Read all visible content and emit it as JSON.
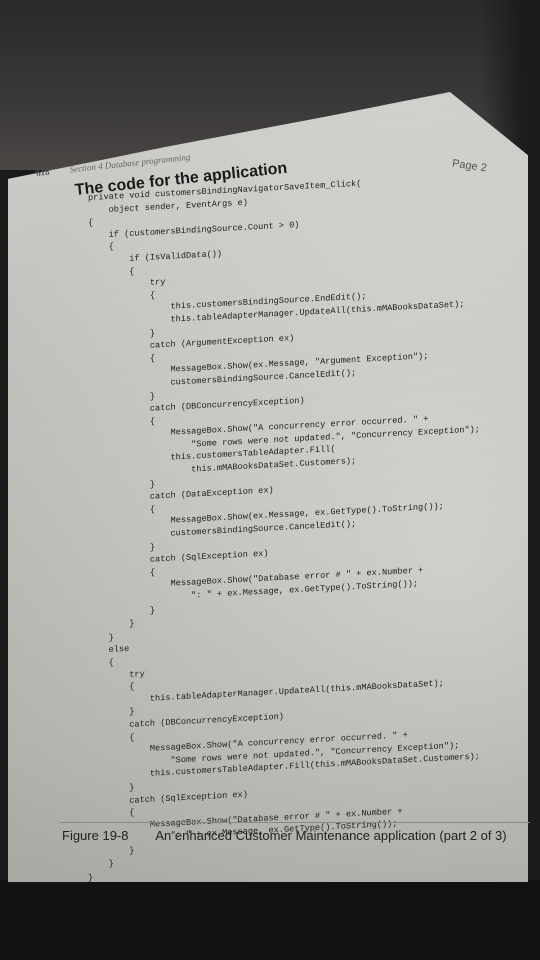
{
  "header": {
    "page_number": "618",
    "section": "Section 4    Database programming",
    "page_mark": "Page 2"
  },
  "title": "The code for the application",
  "code_lines": [
    "private void customersBindingNavigatorSaveItem_Click(",
    "    object sender, EventArgs e)",
    "{",
    "    if (customersBindingSource.Count > 0)",
    "    {",
    "        if (IsValidData())",
    "        {",
    "            try",
    "            {",
    "                this.customersBindingSource.EndEdit();",
    "                this.tableAdapterManager.UpdateAll(this.mMABooksDataSet);",
    "            }",
    "            catch (ArgumentException ex)",
    "            {",
    "                MessageBox.Show(ex.Message, \"Argument Exception\");",
    "                customersBindingSource.CancelEdit();",
    "            }",
    "            catch (DBConcurrencyException)",
    "            {",
    "                MessageBox.Show(\"A concurrency error occurred. \" +",
    "                    \"Some rows were not updated.\", \"Concurrency Exception\");",
    "                this.customersTableAdapter.Fill(",
    "                    this.mMABooksDataSet.Customers);",
    "            }",
    "            catch (DataException ex)",
    "            {",
    "                MessageBox.Show(ex.Message, ex.GetType().ToString());",
    "                customersBindingSource.CancelEdit();",
    "            }",
    "            catch (SqlException ex)",
    "            {",
    "                MessageBox.Show(\"Database error # \" + ex.Number +",
    "                    \": \" + ex.Message, ex.GetType().ToString());",
    "            }",
    "        }",
    "    }",
    "    else",
    "    {",
    "        try",
    "        {",
    "            this.tableAdapterManager.UpdateAll(this.mMABooksDataSet);",
    "        }",
    "        catch (DBConcurrencyException)",
    "        {",
    "            MessageBox.Show(\"A concurrency error occurred. \" +",
    "                \"Some rows were not updated.\", \"Concurrency Exception\");",
    "            this.customersTableAdapter.Fill(this.mMABooksDataSet.Customers);",
    "        }",
    "        catch (SqlException ex)",
    "        {",
    "            MessageBox.Show(\"Database error # \" + ex.Number +",
    "                \": \" + ex.Message, ex.GetType().ToString());",
    "        }",
    "    }",
    "}"
  ],
  "caption": {
    "figure": "Figure 19-8",
    "text": "An enhanced Customer Maintenance application (part 2 of 3)"
  }
}
